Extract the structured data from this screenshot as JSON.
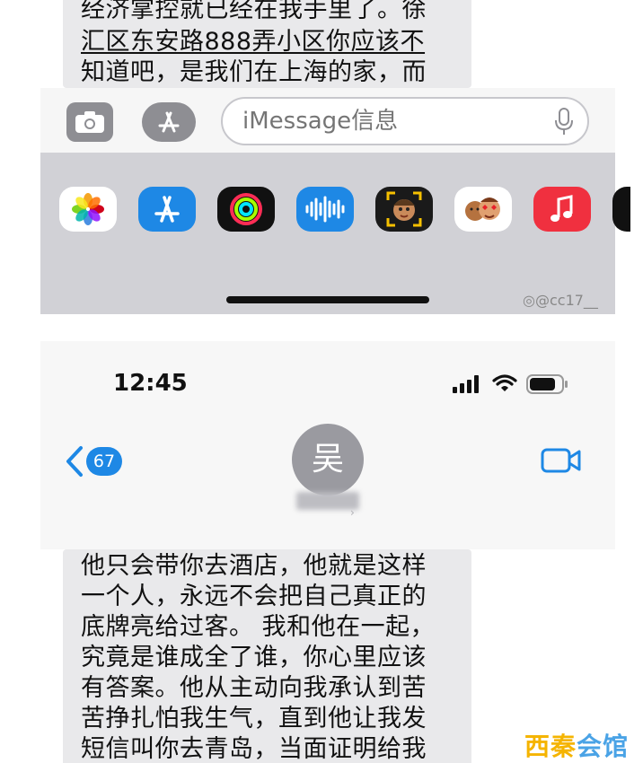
{
  "top_message": {
    "lines": [
      "经济掌控就已经在我手里了。徐",
      "汇区东安路888弄小区你应该不",
      "知道吧，是我们在上海的家，而"
    ]
  },
  "compose": {
    "placeholder": "iMessage信息"
  },
  "app_drawer": {
    "apps": [
      "photos-icon",
      "app-store-icon",
      "fitness-icon",
      "audio-message-icon",
      "memoji-icon",
      "memoji-stickers-icon",
      "music-icon"
    ]
  },
  "weibo_watermark": "@cc17__",
  "status_bar": {
    "time": "12:45"
  },
  "conversation_header": {
    "unread_count": "67",
    "avatar_initial": "吴"
  },
  "bottom_message": {
    "lines": [
      "他只会带你去酒店，他就是这样",
      "一个人，永远不会把自己真正的",
      "底牌亮给过客。 我和他在一起，",
      "究竟是谁成全了谁，你心里应该",
      "有答案。他从主动向我承认到苦",
      "苦挣扎怕我生气，直到他让我发",
      "短信叫你去青岛，当面证明给我"
    ]
  },
  "site_watermark": {
    "part1": "西秦",
    "part2": "会馆"
  },
  "colors": {
    "accent_blue": "#1e88e5",
    "bubble_gray": "#e9e9eb",
    "drawer_gray": "#d1d1d6"
  }
}
